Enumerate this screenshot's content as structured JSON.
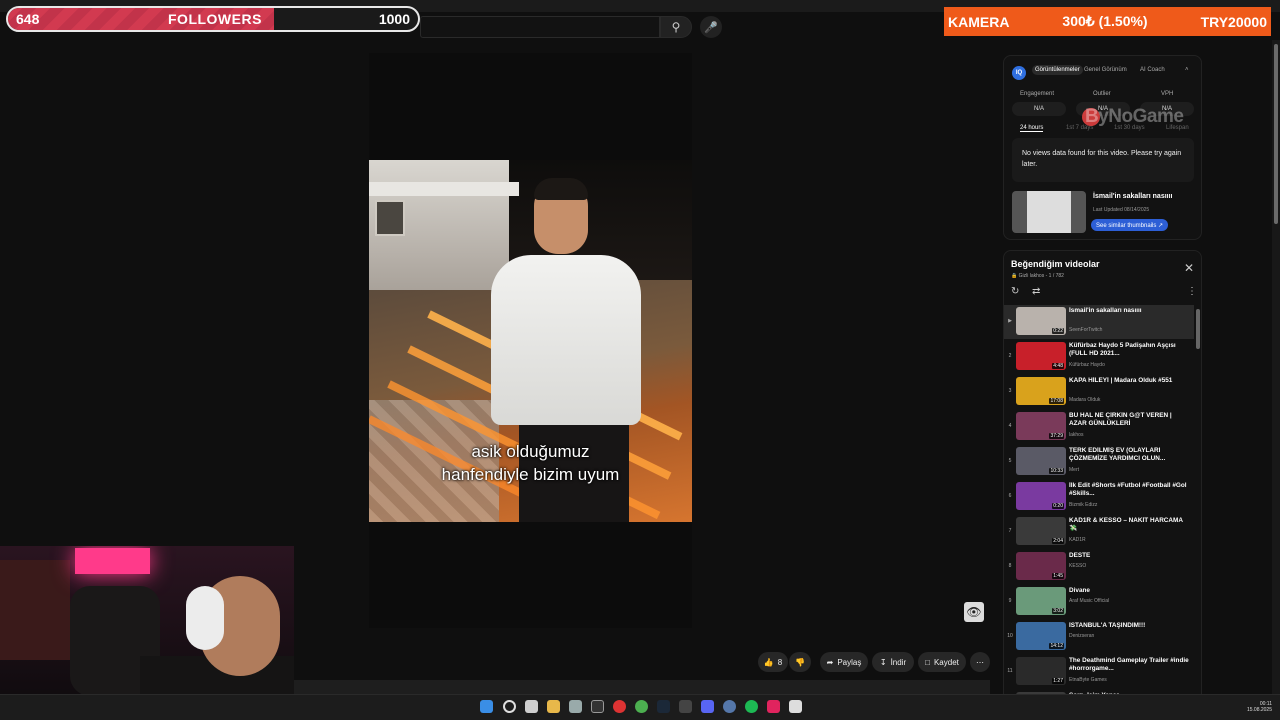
{
  "followers": {
    "current": "648",
    "label": "FOLLOWERS",
    "goal": "1000",
    "progress_fraction": 0.648
  },
  "kamera": {
    "label": "KAMERA",
    "amount": "300₺ (1.50%)",
    "goal": "TRY20000",
    "color": "#ef5a1a"
  },
  "video": {
    "caption_line1": "asik olduğumuz",
    "caption_line2": "hanfendiyle bizim uyum"
  },
  "actions": {
    "like_count": "8",
    "share_label": "Paylaş",
    "download_label": "İndir",
    "save_label": "Kaydet"
  },
  "analytics": {
    "logo": "IQ",
    "tabs": [
      "Görüntülenmeler",
      "Genel Görünüm",
      "AI Coach"
    ],
    "metrics": [
      {
        "label": "Engagement",
        "value": "N/A"
      },
      {
        "label": "Outlier",
        "value": "N/A"
      },
      {
        "label": "VPH",
        "value": "N/A"
      }
    ],
    "time_tabs": [
      "24 hours",
      "1st 7 days",
      "1st 30 days",
      "Lifespan"
    ],
    "message": "No views data found for this video. Please try again later.",
    "similar_title": "İsmail'in sakalları nasıııı",
    "similar_updated": "Last Updated 08/14/2025",
    "similar_button": "See similar thumbnails ↗"
  },
  "watermark": "ByNoGame",
  "playlist": {
    "title": "Beğendiğim videolar",
    "privacy": "Gizli",
    "owner": "lakhos",
    "position": "1 / 782",
    "items": [
      {
        "idx": "▶",
        "title": "İsmail'in sakalları nasıııı",
        "channel": "SeenForTwitch",
        "dur": "0:22",
        "color": "#b9b2ac"
      },
      {
        "idx": "2",
        "title": "Küfürbaz Haydo 5 Padişahın Aşçısı (FULL HD 2021...",
        "channel": "Küfürbaz Haydo",
        "dur": "4:48",
        "color": "#c8202a"
      },
      {
        "idx": "3",
        "title": "KAPA HİLEYİ | Madara Olduk #551",
        "channel": "Madara Olduk",
        "dur": "17:08",
        "color": "#d9a21c"
      },
      {
        "idx": "4",
        "title": "BU HAL NE ÇİRKİN G@T VEREN | AZAR GÜNLÜKLERİ",
        "channel": "lakhos",
        "dur": "37:29",
        "color": "#7a3a5a"
      },
      {
        "idx": "5",
        "title": "TERK EDİLMİŞ EV (OLAYLARI ÇÖZMEMİZE YARDIMCI OLUN...",
        "channel": "Mert",
        "dur": "10:33",
        "color": "#5a5a66"
      },
      {
        "idx": "6",
        "title": "İlk Edit #Shorts #Futbol #Football #Gol #Skills...",
        "channel": "Bizmik Edizz",
        "dur": "0:20",
        "color": "#7a3aa0"
      },
      {
        "idx": "7",
        "title": "KAD1R & KESSO – NAKİT HARCAMA 💸",
        "channel": "KAD1R",
        "dur": "2:04",
        "color": "#3a3a3a"
      },
      {
        "idx": "8",
        "title": "DESTE",
        "channel": "KESSO",
        "dur": "1:45",
        "color": "#6a2a4a"
      },
      {
        "idx": "9",
        "title": "Divane",
        "channel": "Araf Music Official",
        "dur": "3:02",
        "color": "#6a9a7a"
      },
      {
        "idx": "10",
        "title": "İSTANBUL'A TAŞINDIM!!!",
        "channel": "Denizseran",
        "dur": "14:12",
        "color": "#3a6aa0"
      },
      {
        "idx": "11",
        "title": "The Deathmind Gameplay Trailer #indie #horrorgame...",
        "channel": "EtnaByte Games",
        "dur": "1:27",
        "color": "#2a2a2a"
      },
      {
        "idx": "12",
        "title": "Sorn_İçim Yanar",
        "channel": "Sorn_Rap official",
        "dur": "",
        "color": "#3a3a3a"
      }
    ]
  },
  "tray": {
    "time": "00:11",
    "date": "15.08.2025"
  }
}
